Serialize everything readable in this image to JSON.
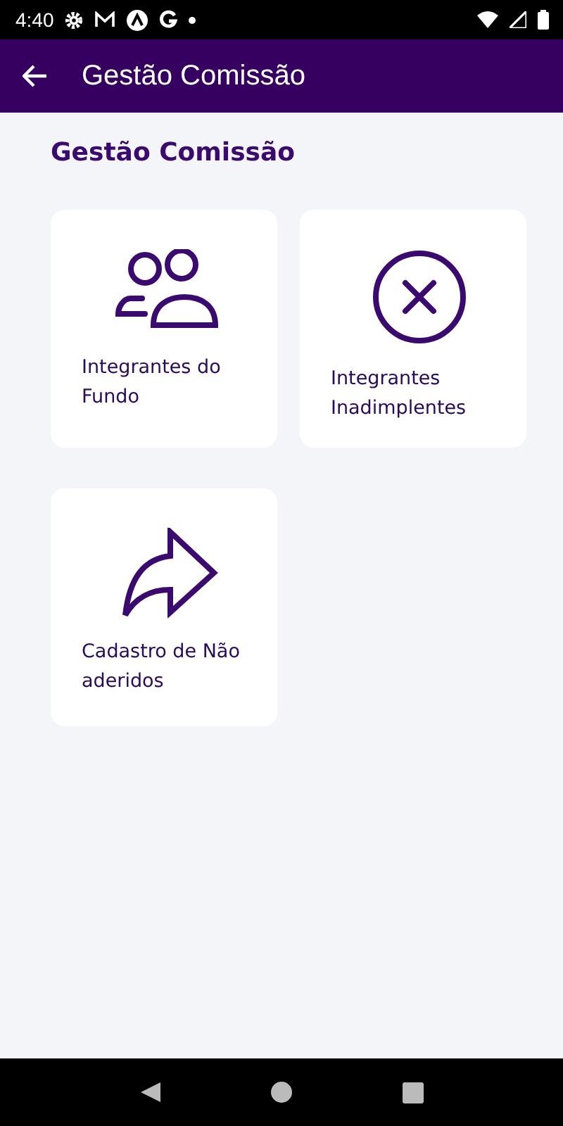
{
  "status_bar": {
    "time": "4:40"
  },
  "app_bar": {
    "title": "Gestão Comissão"
  },
  "section_title": "Gestão Comissão",
  "cards": [
    {
      "kind": "people",
      "label": "Integrantes do Fundo"
    },
    {
      "kind": "cancel",
      "label": "Integrantes Inadimplentes"
    },
    {
      "kind": "share",
      "label": "Cadastro de Não aderidos"
    }
  ]
}
